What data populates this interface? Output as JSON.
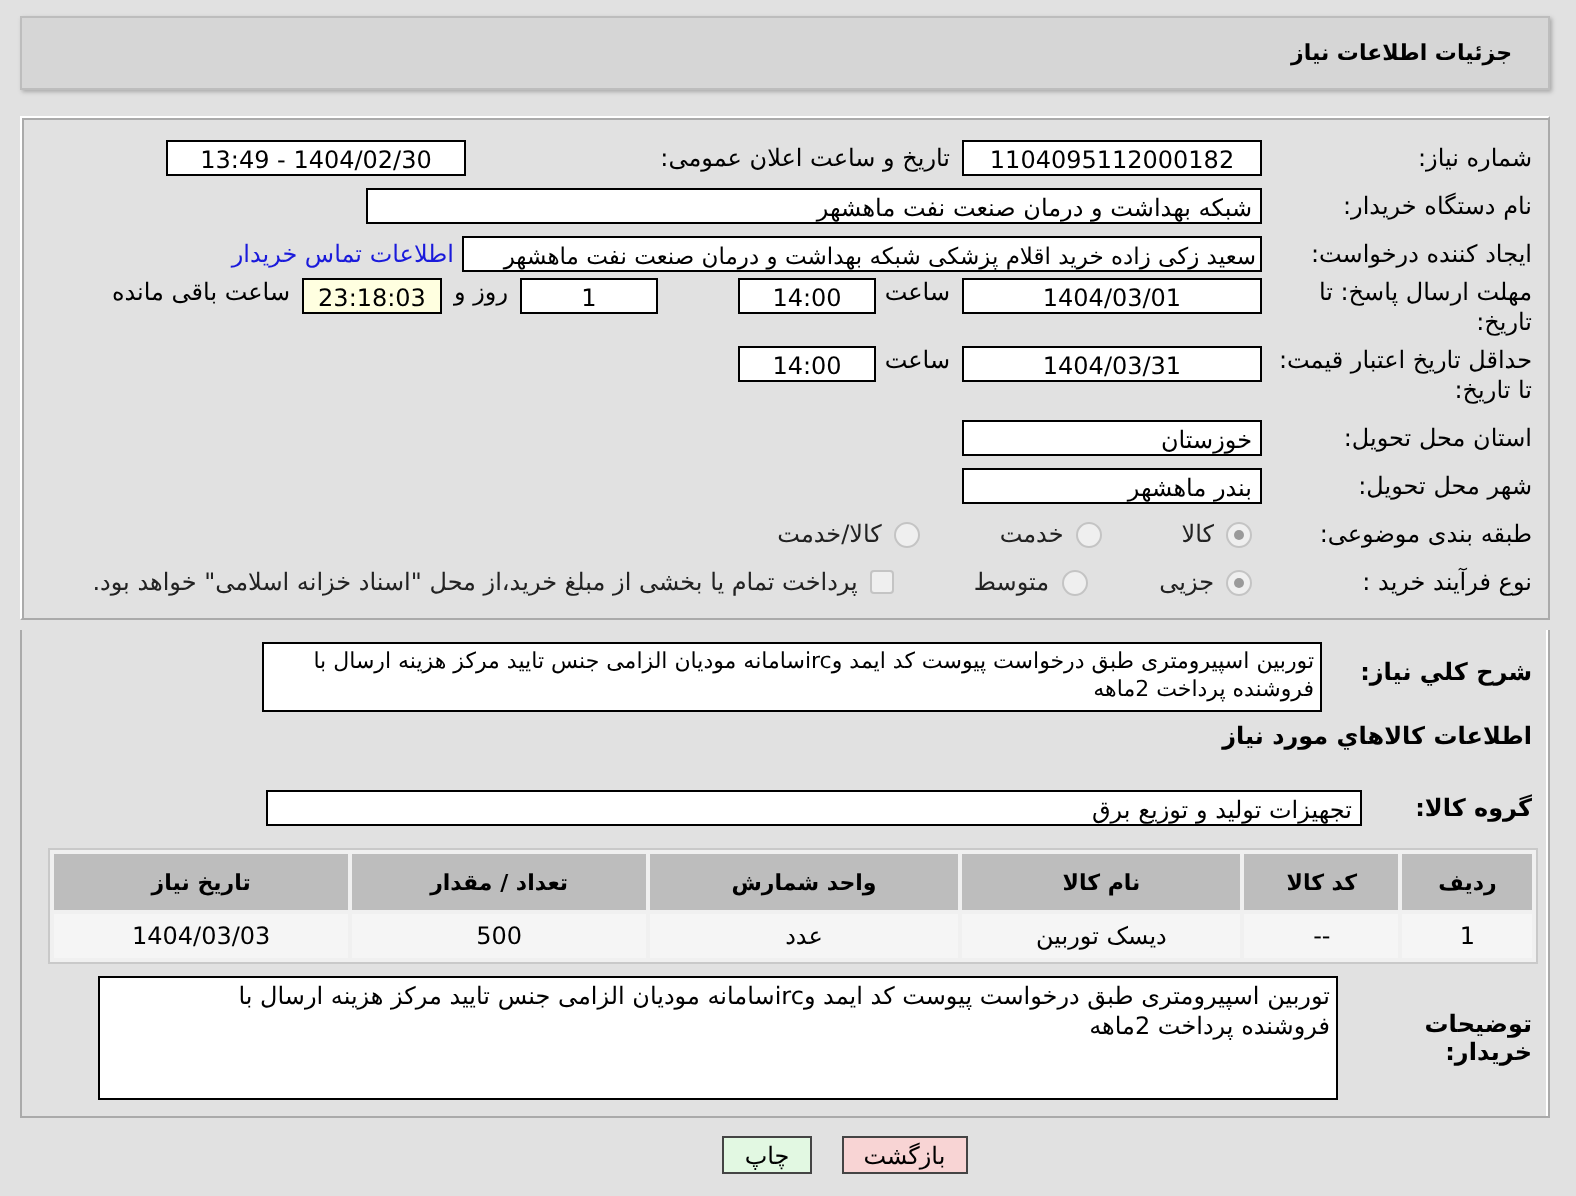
{
  "header": {
    "title": "جزئیات اطلاعات نیاز"
  },
  "need_number": {
    "label": "شماره نیاز:",
    "value": "1104095112000182"
  },
  "announce": {
    "label": "تاریخ و ساعت اعلان عمومی:",
    "value": "1404/02/30 - 13:49"
  },
  "buyer_org": {
    "label": "نام دستگاه خریدار:",
    "value": "شبکه بهداشت و درمان صنعت نفت ماهشهر"
  },
  "creator": {
    "label": "ایجاد کننده درخواست:",
    "value": "سعید زکی زاده خرید اقلام پزشکی شبکه بهداشت و درمان صنعت نفت ماهشهر",
    "link": "اطلاعات تماس خریدار"
  },
  "deadline": {
    "label": "مهلت ارسال پاسخ: تا تاریخ:",
    "date": "1404/03/01",
    "time_label": "ساعت",
    "time": "14:00",
    "days": "1",
    "days_label": "روز و",
    "remaining": "23:18:03",
    "remaining_label": "ساعت باقی مانده"
  },
  "price_validity": {
    "label": "حداقل تاریخ اعتبار قیمت: تا تاریخ:",
    "date": "1404/03/31",
    "time_label": "ساعت",
    "time": "14:00"
  },
  "province": {
    "label": "استان محل تحویل:",
    "value": "خوزستان"
  },
  "city": {
    "label": "شهر محل تحویل:",
    "value": "بندر ماهشهر"
  },
  "category": {
    "label": "طبقه بندی موضوعی:",
    "options": [
      {
        "label": "کالا",
        "selected": true
      },
      {
        "label": "خدمت",
        "selected": false
      },
      {
        "label": "کالا/خدمت",
        "selected": false
      }
    ]
  },
  "process": {
    "label": "نوع فرآیند خرید :",
    "options": [
      {
        "label": "جزیی",
        "selected": true
      },
      {
        "label": "متوسط",
        "selected": false
      }
    ],
    "checkbox": {
      "label": "پرداخت تمام یا بخشی از مبلغ خرید،از محل \"اسناد خزانه اسلامی\" خواهد بود.",
      "checked": false
    }
  },
  "description": {
    "label": "شرح کلي نياز:",
    "value": "توربین اسپیرومتری طبق درخواست پیوست کد ایمد وircسامانه مودیان الزامی جنس تایید مرکز هزینه ارسال با فروشنده پرداخت 2ماهه"
  },
  "items_title": "اطلاعات کالاهاي مورد نياز",
  "goods_group": {
    "label": "گروه کالا:",
    "value": "تجهیزات تولید و توزیع برق"
  },
  "table": {
    "columns": [
      "ردیف",
      "کد کالا",
      "نام کالا",
      "واحد شمارش",
      "تعداد / مقدار",
      "تاریخ نیاز"
    ],
    "rows": [
      [
        "1",
        "--",
        "دیسک توربین",
        "عدد",
        "500",
        "1404/03/03"
      ]
    ]
  },
  "buyer_notes": {
    "label": "توضیحات خریدار:",
    "value": "توربین اسپیرومتری طبق درخواست پیوست کد ایمد وircسامانه مودیان الزامی جنس تایید مرکز هزینه ارسال با فروشنده پرداخت 2ماهه"
  },
  "buttons": [
    {
      "label": "بازگشت",
      "kind": "back"
    },
    {
      "label": "چاپ",
      "kind": "print"
    }
  ]
}
